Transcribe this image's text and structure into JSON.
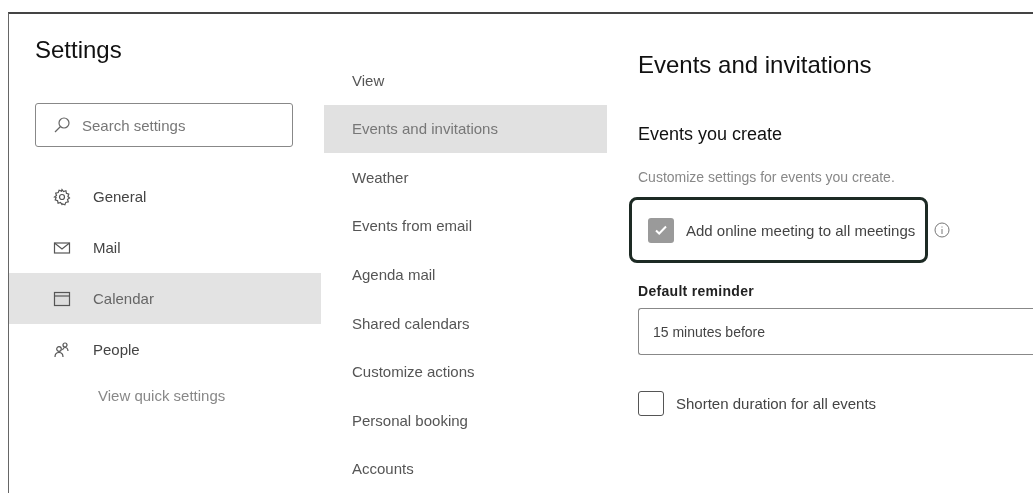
{
  "sidebar": {
    "title": "Settings",
    "search": {
      "placeholder": "Search settings"
    },
    "items": [
      {
        "label": "General",
        "selected": false
      },
      {
        "label": "Mail",
        "selected": false
      },
      {
        "label": "Calendar",
        "selected": true
      },
      {
        "label": "People",
        "selected": false
      }
    ],
    "link": "View quick settings"
  },
  "subnav": {
    "items": [
      {
        "label": "View",
        "selected": false
      },
      {
        "label": "Events and invitations",
        "selected": true
      },
      {
        "label": "Weather",
        "selected": false
      },
      {
        "label": "Events from email",
        "selected": false
      },
      {
        "label": "Agenda mail",
        "selected": false
      },
      {
        "label": "Shared calendars",
        "selected": false
      },
      {
        "label": "Customize actions",
        "selected": false
      },
      {
        "label": "Personal booking",
        "selected": false
      },
      {
        "label": "Accounts",
        "selected": false
      }
    ]
  },
  "content": {
    "title": "Events and invitations",
    "section": "Events you create",
    "description": "Customize settings for events you create.",
    "online_meeting": {
      "label": "Add online meeting to all meetings",
      "checked": true,
      "focused": true
    },
    "reminder": {
      "label": "Default reminder",
      "value": "15 minutes before"
    },
    "shorten": {
      "label": "Shorten duration for all events",
      "checked": false
    }
  }
}
